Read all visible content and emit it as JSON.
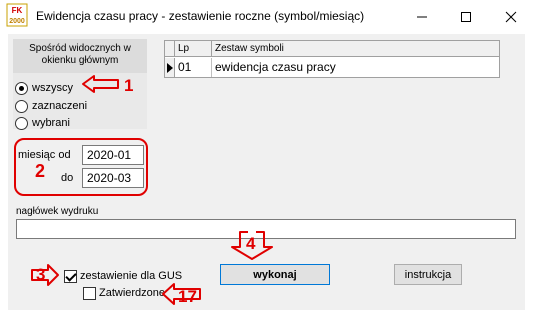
{
  "window": {
    "title": "Ewidencja czasu pracy - zestawienie roczne  (symbol/miesiąc)",
    "app_icon_text": "FK 2000"
  },
  "filter": {
    "header": "Spośród widocznych w okienku głównym",
    "options": [
      {
        "label": "wszyscy",
        "selected": true
      },
      {
        "label": "zaznaczeni",
        "selected": false
      },
      {
        "label": "wybrani",
        "selected": false
      }
    ]
  },
  "months": {
    "from_label": "miesiąc od",
    "from_value": "2020-01",
    "to_label": "do",
    "to_value": "2020-03"
  },
  "grid": {
    "columns": [
      "Lp",
      "Zestaw symboli"
    ],
    "rows": [
      {
        "lp": "01",
        "name": "ewidencja czasu pracy"
      }
    ]
  },
  "header_field": {
    "label": "nagłówek wydruku",
    "value": ""
  },
  "options": {
    "gus_label": "zestawienie dla GUS",
    "gus_checked": true,
    "approved_label": "Zatwierdzone",
    "approved_checked": false
  },
  "buttons": {
    "run": "wykonaj",
    "instructions": "instrukcja"
  },
  "annotations": {
    "n1": "1",
    "n2": "2",
    "n3": "3",
    "n4": "4",
    "n17": "17"
  },
  "colors": {
    "annotation": "#e00000",
    "focus": "#0078d7",
    "client_bg": "#f0f0f0"
  }
}
